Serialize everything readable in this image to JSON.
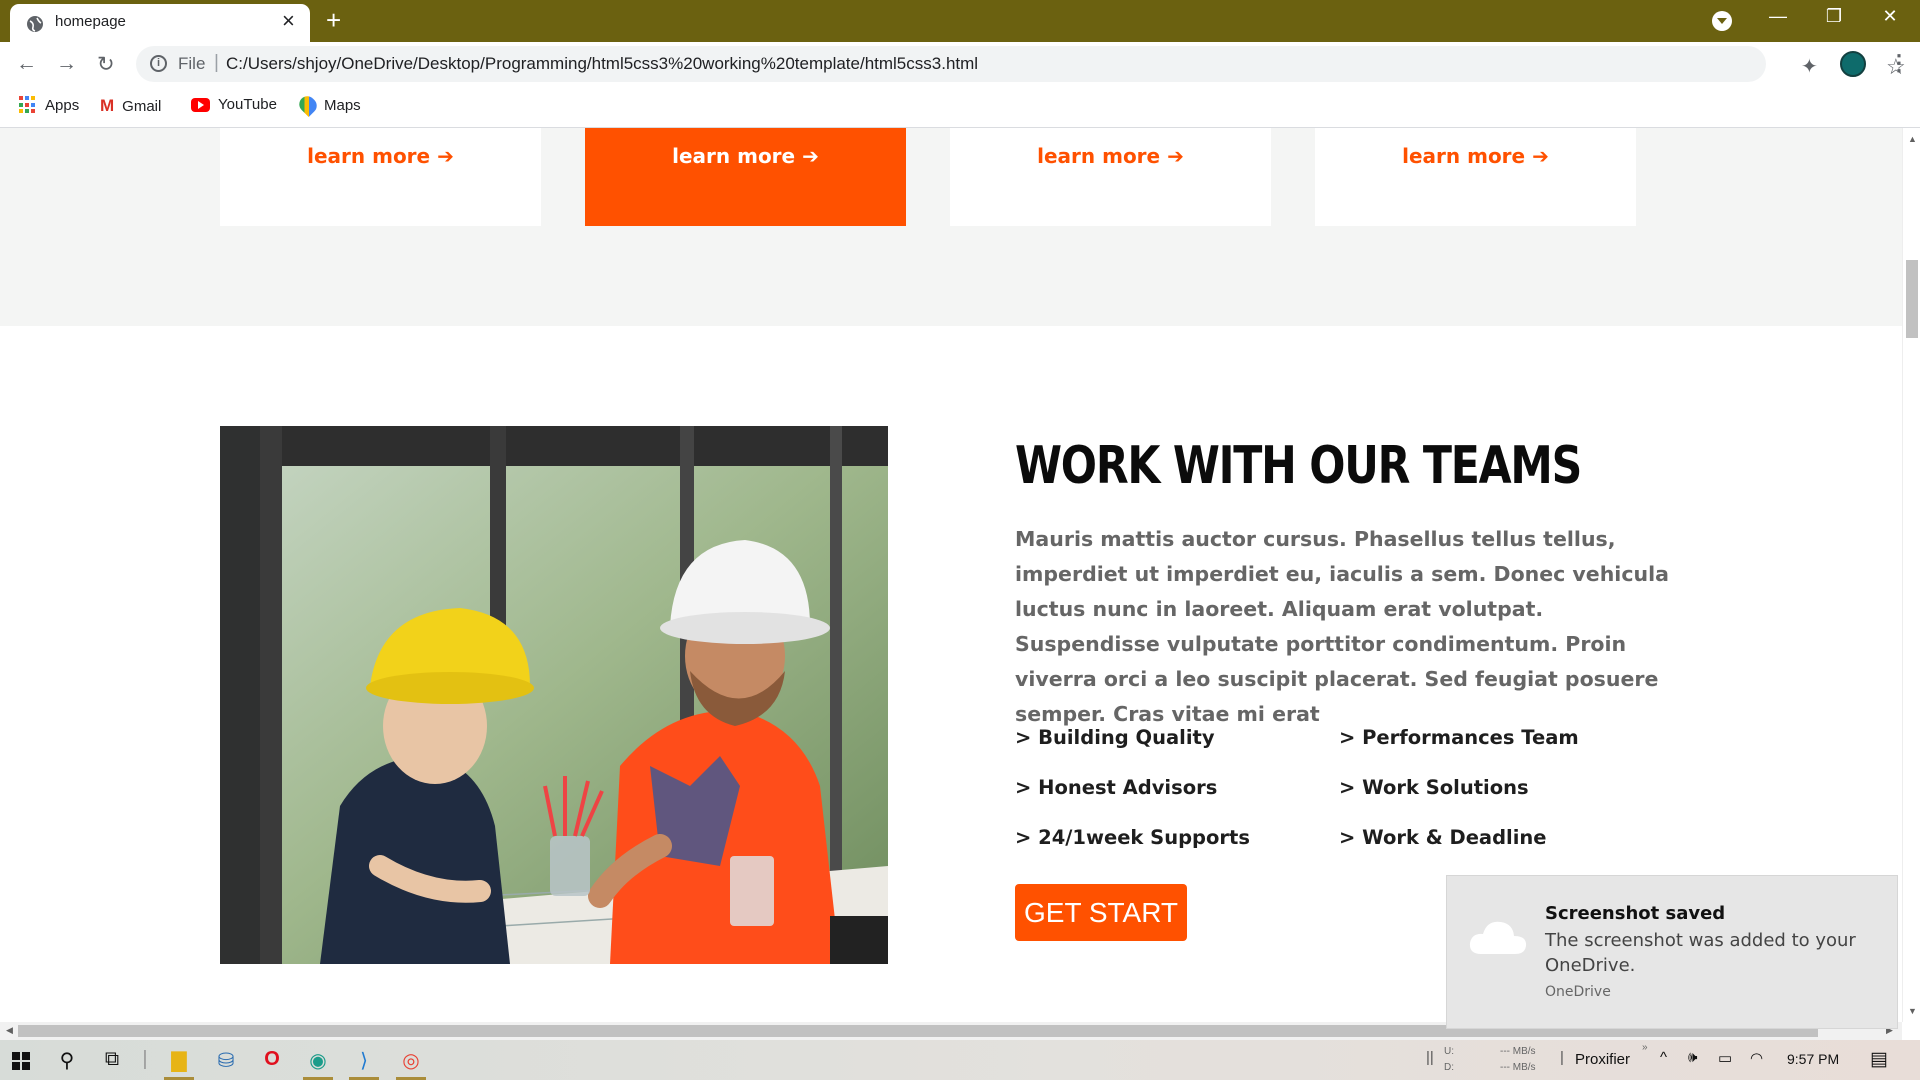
{
  "browser": {
    "tab_title": "homepage",
    "url_scheme": "File",
    "url": "C:/Users/shjoy/OneDrive/Desktop/Programming/html5css3%20working%20template/html5css3.html",
    "bookmarks": [
      {
        "label": "Apps",
        "icon": "apps-grid-icon"
      },
      {
        "label": "Gmail",
        "icon": "gmail-icon"
      },
      {
        "label": "YouTube",
        "icon": "youtube-icon"
      },
      {
        "label": "Maps",
        "icon": "maps-icon"
      }
    ]
  },
  "services": {
    "cards": [
      {
        "link_label": "learn more",
        "active": false
      },
      {
        "link_label": "learn more",
        "active": true
      },
      {
        "link_label": "learn more",
        "active": false
      },
      {
        "link_label": "learn more",
        "active": false
      }
    ],
    "accent_color": "#ff5100"
  },
  "team_section": {
    "heading": "WORK WITH OUR TEAMS",
    "paragraph": "Mauris mattis auctor cursus. Phasellus tellus tellus, imperdiet ut imperdiet eu, iaculis a sem. Donec vehicula luctus nunc in laoreet. Aliquam erat volutpat. Suspendisse vulputate porttitor condimentum. Proin viverra orci a leo suscipit placerat. Sed feugiat posuere semper. Cras vitae mi erat",
    "features_left": [
      "> Building Quality",
      "> Honest Advisors",
      "> 24/1week Supports"
    ],
    "features_right": [
      "> Performances Team",
      "> Work Solutions",
      "> Work & Deadline"
    ],
    "cta_label": "GET START",
    "image": "two-engineers-in-hard-hats-reviewing-blueprints"
  },
  "toast": {
    "title": "Screenshot saved",
    "body": "The screenshot was added to your OneDrive.",
    "source": "OneDrive"
  },
  "taskbar": {
    "tray_label": "Proxifier",
    "net_up_label": "U:",
    "net_down_label": "D:",
    "net_up_rate": "--- MB/s",
    "net_down_rate": "--- MB/s",
    "time": "9:57 PM"
  }
}
